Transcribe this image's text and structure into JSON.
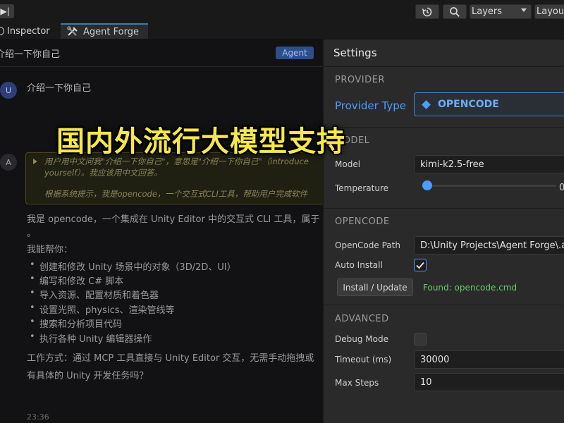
{
  "toolbar": {
    "play_icon": "step-forward-icon",
    "history_icon": "history-icon",
    "search_icon": "search-icon",
    "layers_label": "Layers",
    "layout_label": "Layout"
  },
  "tabs": [
    {
      "label": "Inspector",
      "icon": "info-icon"
    },
    {
      "label": "Agent Forge",
      "icon": "tools-icon"
    }
  ],
  "chat": {
    "header_title": "介绍一下你自己",
    "mode_badge": "Agent",
    "user_avatar": "U",
    "user_message": "介绍一下你自己",
    "assistant_avatar": "A",
    "thinking_line1": "用户用中文问我\"介绍一下你自己\"，意思是\"介绍一下你自己\"（introduce",
    "thinking_line2": "yourself）。我应该用中文回答。",
    "thinking_line3": "根据系统提示，我是opencode，一个交互式CLI工具，帮助用户完成软件",
    "reply_intro": "我是 opencode，一个集成在 Unity Editor 中的交互式 CLI 工具，属于",
    "reply_intro_cont": "。",
    "reply_can_help": "我能帮你：",
    "bullets": [
      "创建和修改 Unity 场景中的对象（3D/2D、UI）",
      "编写和修改 C# 脚本",
      "导入资源、配置材质和着色器",
      "设置光照、physics、渲染管线等",
      "搜索和分析项目代码",
      "执行各种 Unity 编辑器操作"
    ],
    "reply_workflow": "工作方式：通过 MCP 工具直接与 Unity Editor 交互，无需手动拖拽或",
    "reply_question": "有具体的 Unity 开发任务吗？",
    "timestamp": "23:36"
  },
  "overlay_caption": "国内外流行大模型支持",
  "settings": {
    "title": "Settings",
    "provider_section": "PROVIDER",
    "provider_type_label": "Provider Type",
    "provider_type_value": "OPENCODE",
    "model_section": "MODEL",
    "model_label": "Model",
    "model_value": "kimi-k2.5-free",
    "temperature_label": "Temperature",
    "temperature_value": "0",
    "opencode_section": "OPENCODE",
    "path_label": "OpenCode Path",
    "path_value": "D:\\Unity Projects\\Agent Forge\\.a",
    "auto_install_label": "Auto Install",
    "auto_install_checked": true,
    "install_button": "Install / Update",
    "found_text": "Found: opencode.cmd",
    "advanced_section": "ADVANCED",
    "debug_label": "Debug Mode",
    "debug_checked": false,
    "timeout_label": "Timeout (ms)",
    "timeout_value": "30000",
    "max_steps_label": "Max Steps",
    "max_steps_value": "10"
  },
  "colors": {
    "accent": "#4a9eff",
    "found_green": "#6bc96b",
    "overlay_yellow": "#f6e84a"
  }
}
